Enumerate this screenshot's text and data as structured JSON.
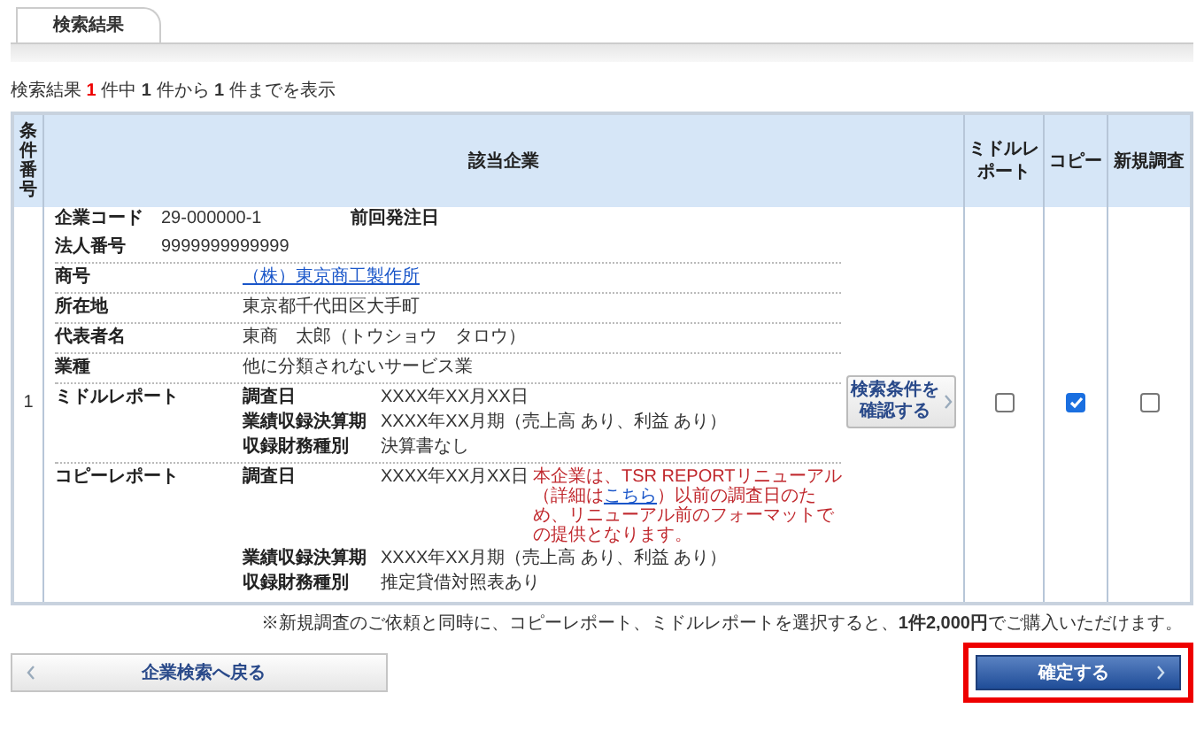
{
  "tabs": [
    {
      "label": "検索結果",
      "selected": true
    }
  ],
  "summary": {
    "label": "検索結果",
    "total": "1",
    "of": "件中",
    "from": "1",
    "from_suffix": "件から",
    "to": "1",
    "to_suffix": "件までを表示"
  },
  "table": {
    "columns": [
      {
        "label": "条件番号",
        "kind": "vertical"
      },
      {
        "label": "該当企業",
        "kind": "wide"
      },
      {
        "label": "ミドルレポート",
        "kind": "narrow"
      },
      {
        "label": "コピー",
        "kind": "narrow"
      },
      {
        "label": "新規調査",
        "kind": "narrow"
      }
    ],
    "rows": [
      {
        "number": "1",
        "head_fields": [
          {
            "label": "企業コード",
            "value": "29-000000-1",
            "extra_label": "前回発注日"
          },
          {
            "label": "法人番号",
            "value": "9999999999999"
          }
        ],
        "fields": [
          {
            "label": "商号",
            "value": "（株）東京商工製作所",
            "kind": "link"
          },
          {
            "label": "所在地",
            "value": "東京都千代田区大手町",
            "kind": "text"
          },
          {
            "label": "代表者名",
            "value": "東商　太郎（トウショウ　タロウ）",
            "kind": "text"
          },
          {
            "label": "業種",
            "value": "他に分類されないサービス業",
            "kind": "text"
          }
        ],
        "reports": [
          {
            "label": "ミドルレポート",
            "details": [
              {
                "label": "調査日",
                "value": "XXXX年XX月XX日"
              },
              {
                "label": "業績収録決算期",
                "value": "XXXX年XX月期（売上高 あり、利益 あり）"
              },
              {
                "label": "収録財務種別",
                "value": "決算書なし"
              }
            ]
          },
          {
            "label": "コピーレポート",
            "details": [
              {
                "label": "調査日",
                "value": "XXXX年XX月XX日",
                "note": {
                  "before": "本企業は、TSR REPORTリニューアル（詳細は",
                  "link": "こちら",
                  "after": "）以前の調査日のため、リニューアル前のフォーマットでの提供となります。"
                }
              },
              {
                "label": "業績収録決算期",
                "value": "XXXX年XX月期（売上高 あり、利益 あり）"
              },
              {
                "label": "収録財務種別",
                "value": "推定貸借対照表あり"
              }
            ]
          }
        ],
        "confirm_button": "検索条件を確認する",
        "checks": [
          {
            "checked": false
          },
          {
            "checked": true
          },
          {
            "checked": false
          }
        ]
      }
    ]
  },
  "footnote": "※新規調査のご依頼と同時に、コピーレポート、ミドルレポートを選択すると、**1件2,000円**でご購入いただけます。",
  "back_button": {
    "label": "企業検索へ戻る"
  },
  "submit_button": {
    "label": "確定する",
    "highlighted": true
  }
}
